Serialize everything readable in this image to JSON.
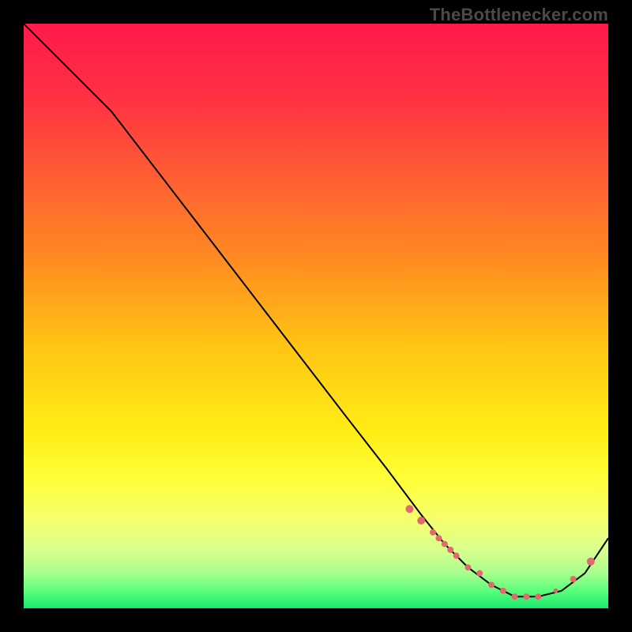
{
  "watermark": "TheBottlenecker.com",
  "colors": {
    "bg": "#000000",
    "curve": "#000000",
    "marker": "#e16a6f",
    "gradient_stops": [
      {
        "pct": 0,
        "color": "#ff1a4b"
      },
      {
        "pct": 12,
        "color": "#ff2f44"
      },
      {
        "pct": 25,
        "color": "#ff5a34"
      },
      {
        "pct": 40,
        "color": "#ff8a22"
      },
      {
        "pct": 55,
        "color": "#ffc414"
      },
      {
        "pct": 70,
        "color": "#ffee16"
      },
      {
        "pct": 78,
        "color": "#ffff3a"
      },
      {
        "pct": 85,
        "color": "#f4ff6e"
      },
      {
        "pct": 90,
        "color": "#d9ff8e"
      },
      {
        "pct": 94,
        "color": "#a8ff8e"
      },
      {
        "pct": 97,
        "color": "#5bff7a"
      },
      {
        "pct": 100,
        "color": "#19e86f"
      }
    ]
  },
  "chart_data": {
    "type": "line",
    "title": "",
    "xlabel": "",
    "ylabel": "",
    "xlim": [
      0,
      100
    ],
    "ylim": [
      0,
      100
    ],
    "curve": {
      "x": [
        0,
        3,
        8,
        15,
        25,
        35,
        45,
        55,
        62,
        68,
        72,
        76,
        80,
        84,
        88,
        92,
        96,
        100
      ],
      "y": [
        100,
        97,
        92,
        85,
        72,
        59,
        46,
        33,
        24,
        16,
        11,
        7,
        4,
        2,
        2,
        3,
        6,
        12
      ]
    },
    "marker_cluster": {
      "note": "points on the curve near the minimum, shown as salmon dots",
      "x": [
        66,
        68,
        70,
        71,
        72,
        73,
        74,
        76,
        78,
        80,
        82,
        84,
        86,
        88,
        91,
        94,
        97
      ],
      "y": [
        17,
        15,
        13,
        12,
        11,
        10,
        9,
        7,
        6,
        4,
        3,
        2,
        2,
        2,
        3,
        5,
        8
      ],
      "r": [
        5,
        5,
        4,
        4,
        4,
        4,
        4,
        4,
        4,
        4,
        4,
        4,
        4,
        4,
        3,
        4,
        5
      ]
    }
  }
}
